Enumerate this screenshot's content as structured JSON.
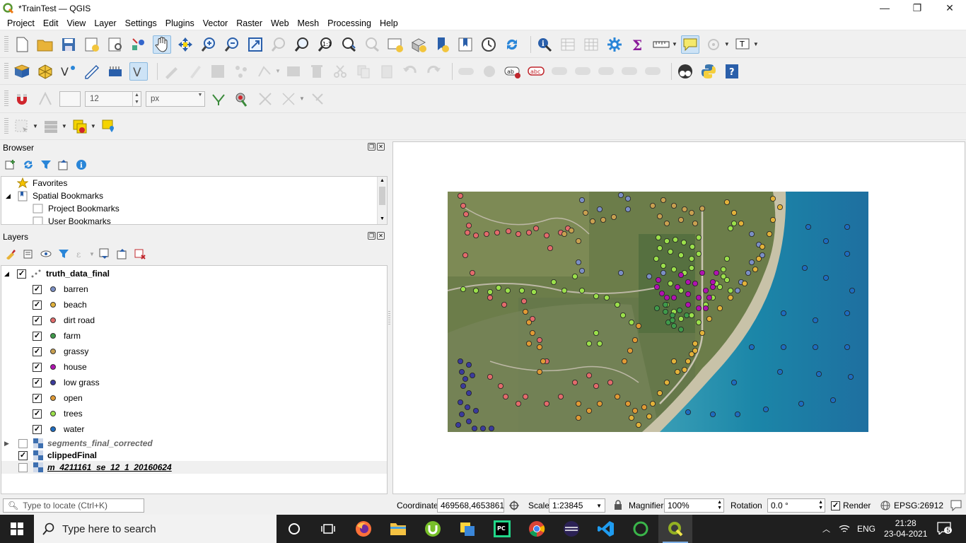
{
  "window": {
    "title": "*TrainTest — QGIS",
    "min": "—",
    "max": "❐",
    "close": "✕"
  },
  "menu": [
    "Project",
    "Edit",
    "View",
    "Layer",
    "Settings",
    "Plugins",
    "Vector",
    "Raster",
    "Web",
    "Mesh",
    "Processing",
    "Help"
  ],
  "snap": {
    "tolerance": "12",
    "unit": "px"
  },
  "browser": {
    "title": "Browser",
    "items": [
      {
        "label": "Favorites",
        "icon": "star-icon"
      },
      {
        "label": "Spatial Bookmarks",
        "icon": "bookmark-folder-icon"
      },
      {
        "label": "Project Bookmarks",
        "icon": "folder-icon"
      },
      {
        "label": "User Bookmarks",
        "icon": "folder-icon"
      }
    ]
  },
  "layers": {
    "title": "Layers",
    "group": "truth_data_final",
    "classes": [
      {
        "label": "barren",
        "color": "#7b8fc5"
      },
      {
        "label": "beach",
        "color": "#e2b23a"
      },
      {
        "label": "dirt road",
        "color": "#e26b6b"
      },
      {
        "label": "farm",
        "color": "#3f9a4a"
      },
      {
        "label": "grassy",
        "color": "#c8a050"
      },
      {
        "label": "house",
        "color": "#b012b0"
      },
      {
        "label": "low grass",
        "color": "#3b3b9c"
      },
      {
        "label": "open",
        "color": "#e09a35"
      },
      {
        "label": "trees",
        "color": "#9be04b"
      },
      {
        "label": "water",
        "color": "#1e6cc0"
      }
    ],
    "rasters": [
      {
        "label": "segments_final_corrected",
        "checked": false
      },
      {
        "label": "clippedFinal",
        "checked": true
      },
      {
        "label": "m_4211161_se_12_1_20160624",
        "checked": false
      }
    ]
  },
  "status": {
    "locate_placeholder": "Type to locate (Ctrl+K)",
    "coordinate_label": "Coordinate",
    "coordinate": "469568,4653861",
    "scale_label": "Scale",
    "scale": "1:23845",
    "magnifier_label": "Magnifier",
    "magnifier": "100%",
    "rotation_label": "Rotation",
    "rotation": "0.0 °",
    "render_label": "Render",
    "crs": "EPSG:26912"
  },
  "taskbar": {
    "search": "Type here to search",
    "lang": "ENG",
    "time": "21:28",
    "date": "23-04-2021",
    "notif": "5"
  }
}
